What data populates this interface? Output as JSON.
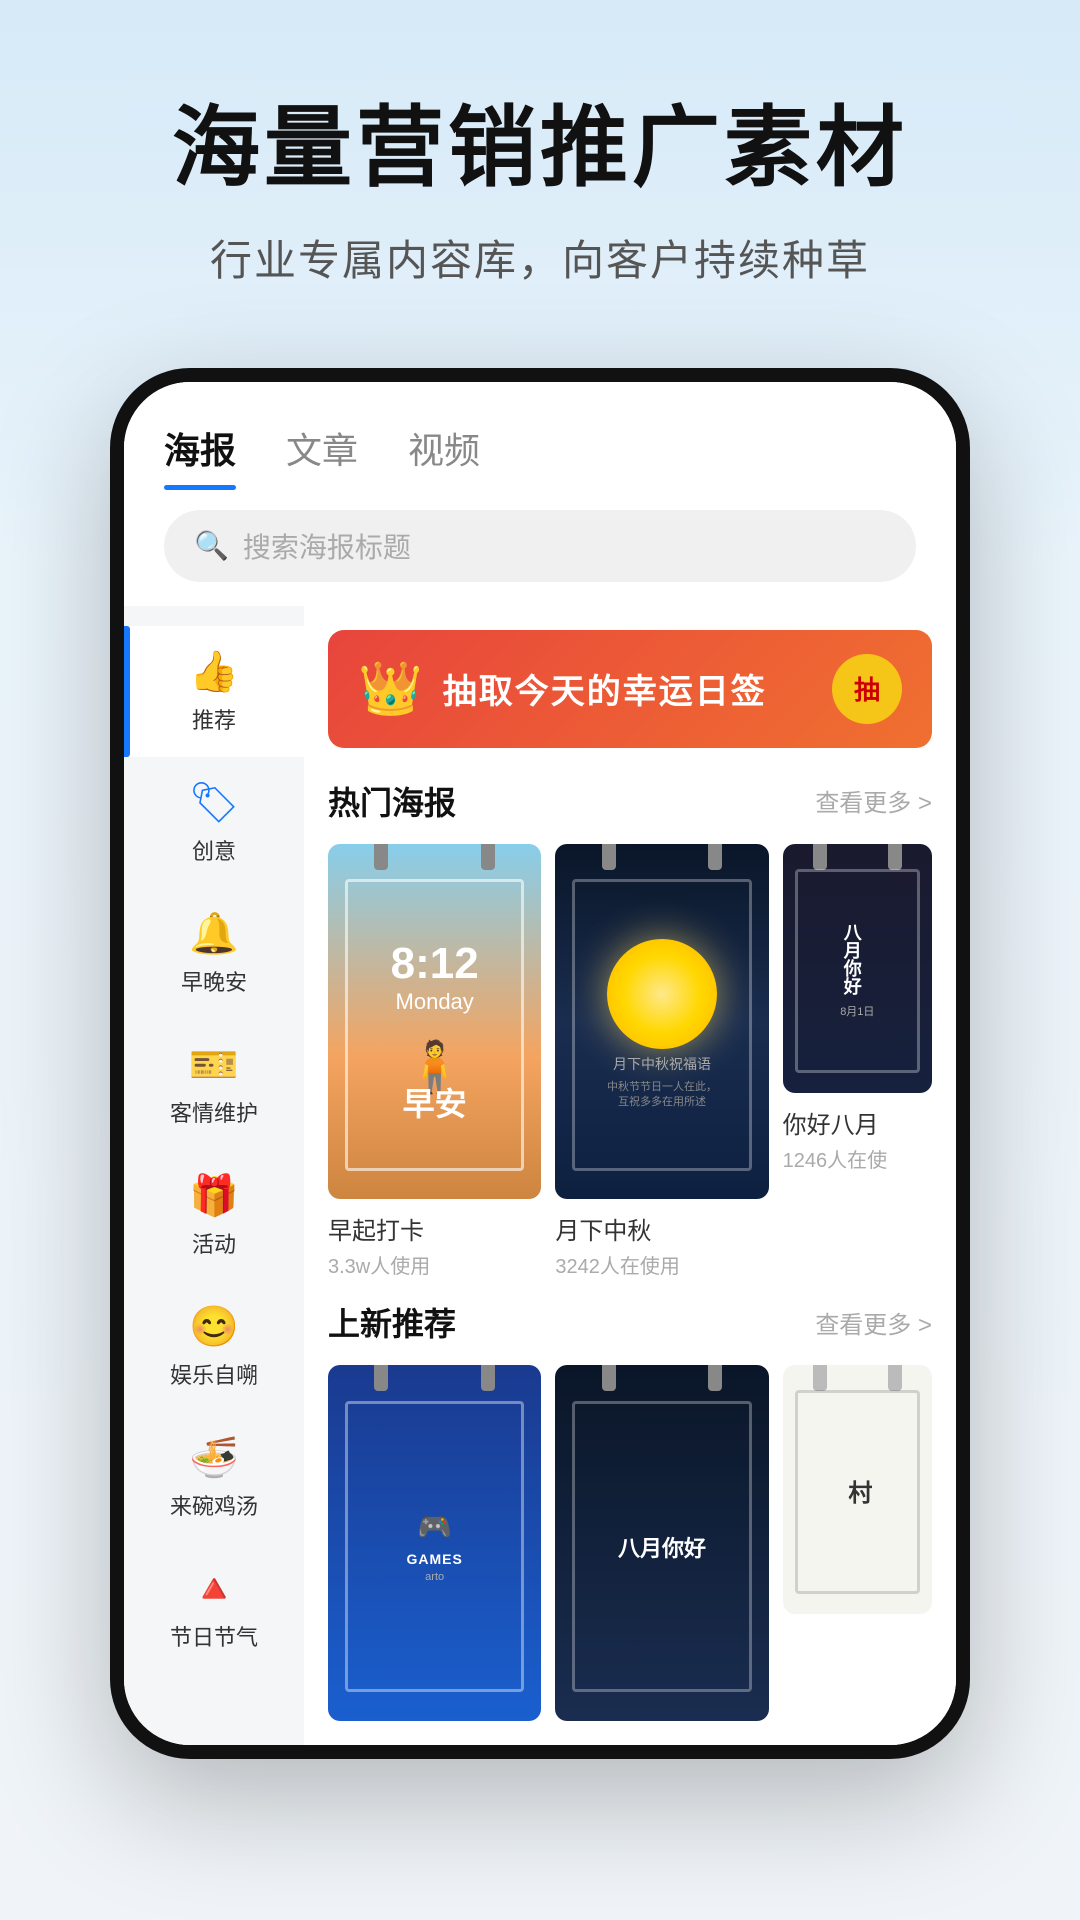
{
  "hero": {
    "title": "海量营销推广素材",
    "subtitle": "行业专属内容库，向客户持续种草"
  },
  "app": {
    "tabs": [
      {
        "id": "poster",
        "label": "海报",
        "active": true
      },
      {
        "id": "article",
        "label": "文章",
        "active": false
      },
      {
        "id": "video",
        "label": "视频",
        "active": false
      }
    ],
    "search": {
      "placeholder": "搜索海报标题"
    },
    "sidebar": [
      {
        "id": "recommend",
        "label": "推荐",
        "active": true,
        "icon": "👍"
      },
      {
        "id": "creative",
        "label": "创意",
        "active": false,
        "icon": "🏷"
      },
      {
        "id": "morning",
        "label": "早晚安",
        "active": false,
        "icon": "🔔"
      },
      {
        "id": "customer",
        "label": "客情维护",
        "active": false,
        "icon": "🎫"
      },
      {
        "id": "activity",
        "label": "活动",
        "active": false,
        "icon": "🎁"
      },
      {
        "id": "entertainment",
        "label": "娱乐自嗍",
        "active": false,
        "icon": "😊"
      },
      {
        "id": "chicken",
        "label": "来碗鸡汤",
        "active": false,
        "icon": "🍜"
      },
      {
        "id": "holiday",
        "label": "节日节气",
        "active": false,
        "icon": "🔺"
      }
    ],
    "banner": {
      "icon": "👑",
      "text": "抽取今天的幸运日签",
      "button": "抽"
    },
    "hot_section": {
      "title": "热门海报",
      "more": "查看更多 >"
    },
    "posters": [
      {
        "id": "morning-checkin",
        "time": "8:12",
        "day": "Monday",
        "greeting": "早安",
        "name": "早起打卡",
        "usage": "3.3w人使用"
      },
      {
        "id": "mid-autumn",
        "name": "月下中秋",
        "usage": "3242人在使用"
      },
      {
        "id": "hello-august",
        "name": "你好八月",
        "usage": "1246人在使"
      }
    ],
    "new_section": {
      "title": "上新推荐",
      "more": "查看更多 >"
    },
    "new_posters": [
      {
        "id": "new-1",
        "name": ""
      },
      {
        "id": "new-2",
        "name": "八月你好"
      },
      {
        "id": "new-3",
        "name": ""
      }
    ]
  }
}
